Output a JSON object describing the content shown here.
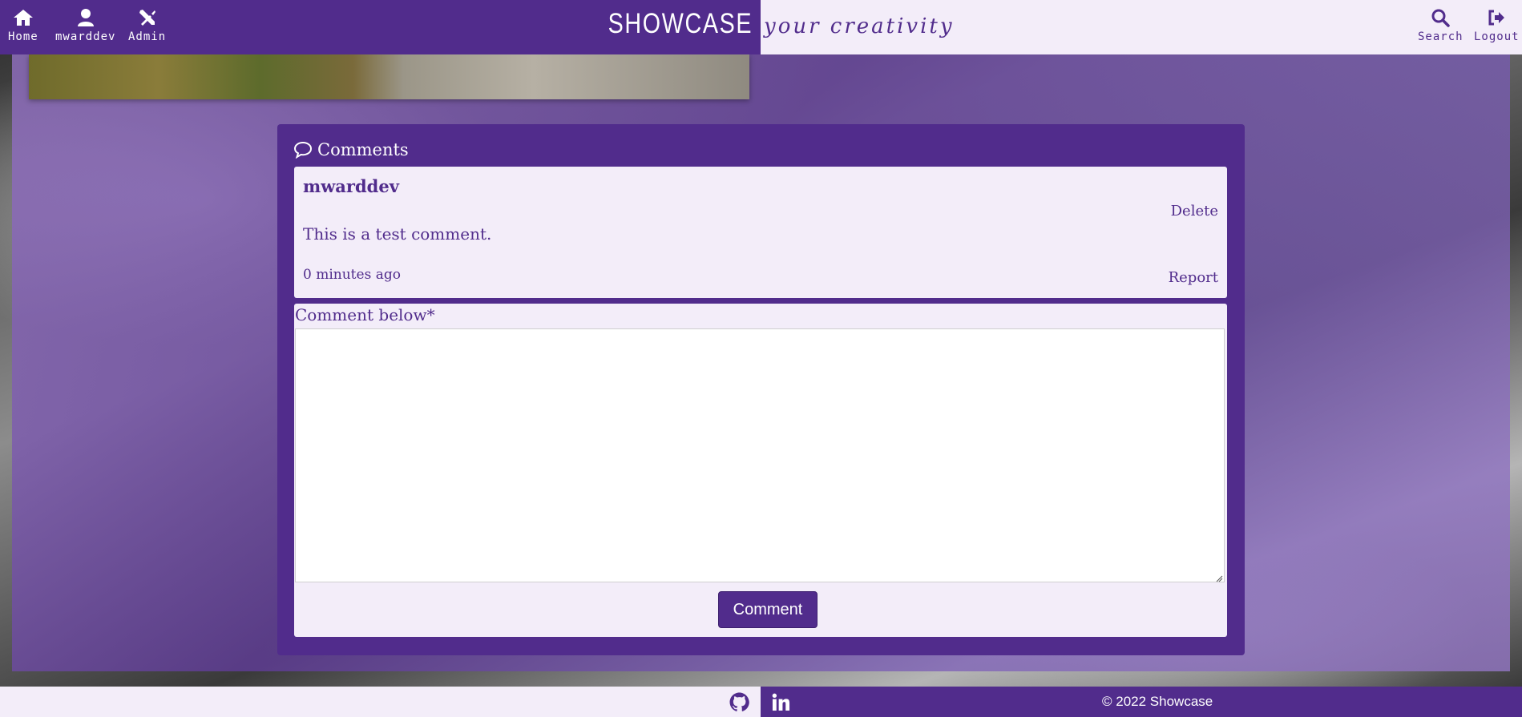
{
  "nav": {
    "home_label": "Home",
    "profile_label": "mwarddev",
    "admin_label": "Admin",
    "search_label": "Search",
    "logout_label": "Logout",
    "brand": "SHOWCASE",
    "tagline": "your creativity"
  },
  "comments": {
    "title": "Comments",
    "items": [
      {
        "author": "mwarddev",
        "delete_label": "Delete",
        "body": "This is a test comment.",
        "time": "0 minutes ago",
        "report_label": "Report"
      }
    ]
  },
  "form": {
    "label": "Comment below*",
    "textarea_value": "",
    "submit_label": "Comment"
  },
  "footer": {
    "copyright": "© 2022 Showcase",
    "icons": [
      "github-icon",
      "linkedin-icon"
    ]
  },
  "colors": {
    "brand_purple": "#512c8c",
    "light_lavender": "#f3edf9"
  }
}
